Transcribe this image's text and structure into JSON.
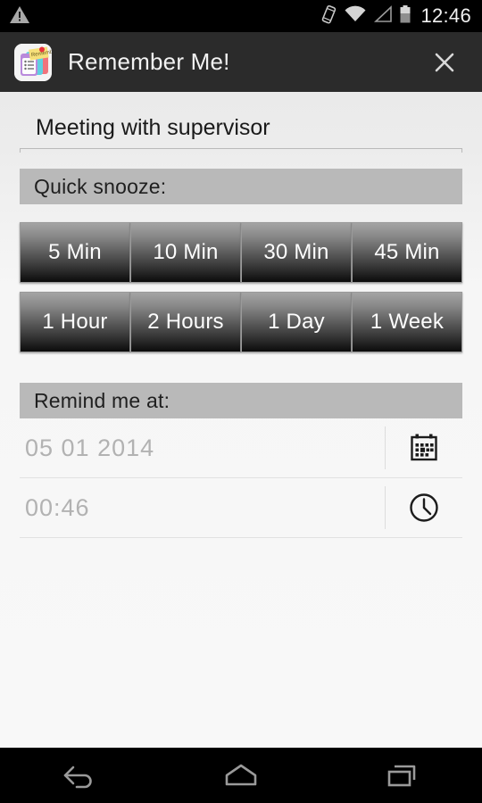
{
  "status_bar": {
    "warning_icon": "warning-triangle-icon",
    "vibrate_icon": "vibrate-icon",
    "wifi_icon": "wifi-icon",
    "signal_icon": "cellular-signal-icon",
    "battery_icon": "battery-icon",
    "time": "12:46"
  },
  "header": {
    "app_icon": "remember-me-app-icon",
    "title": "Remember Me!",
    "close_label": "close-icon"
  },
  "reminder": {
    "title_value": "Meeting with supervisor",
    "title_placeholder": "Reminder title"
  },
  "quick_snooze": {
    "section_label": "Quick snooze:",
    "buttons": [
      {
        "label": "5 Min"
      },
      {
        "label": "10 Min"
      },
      {
        "label": "30 Min"
      },
      {
        "label": "45 Min"
      },
      {
        "label": "1 Hour"
      },
      {
        "label": "2 Hours"
      },
      {
        "label": "1 Day"
      },
      {
        "label": "1 Week"
      }
    ]
  },
  "remind_me": {
    "section_label": "Remind me at:",
    "date_value": "05 01 2014",
    "date_icon": "calendar-icon",
    "time_value": "00:46",
    "time_icon": "clock-icon"
  },
  "nav_bar": {
    "back": "back-icon",
    "home": "home-icon",
    "recents": "recents-icon"
  },
  "colors": {
    "status_bar_bg": "#000000",
    "header_bg": "#2b2b2b",
    "content_bg": "#f2f2f2",
    "section_bar_bg": "#b9b9b9",
    "button_top": "#a4a4a4",
    "button_bottom": "#0b0b0b",
    "placeholder_text": "#b2b2b2"
  }
}
